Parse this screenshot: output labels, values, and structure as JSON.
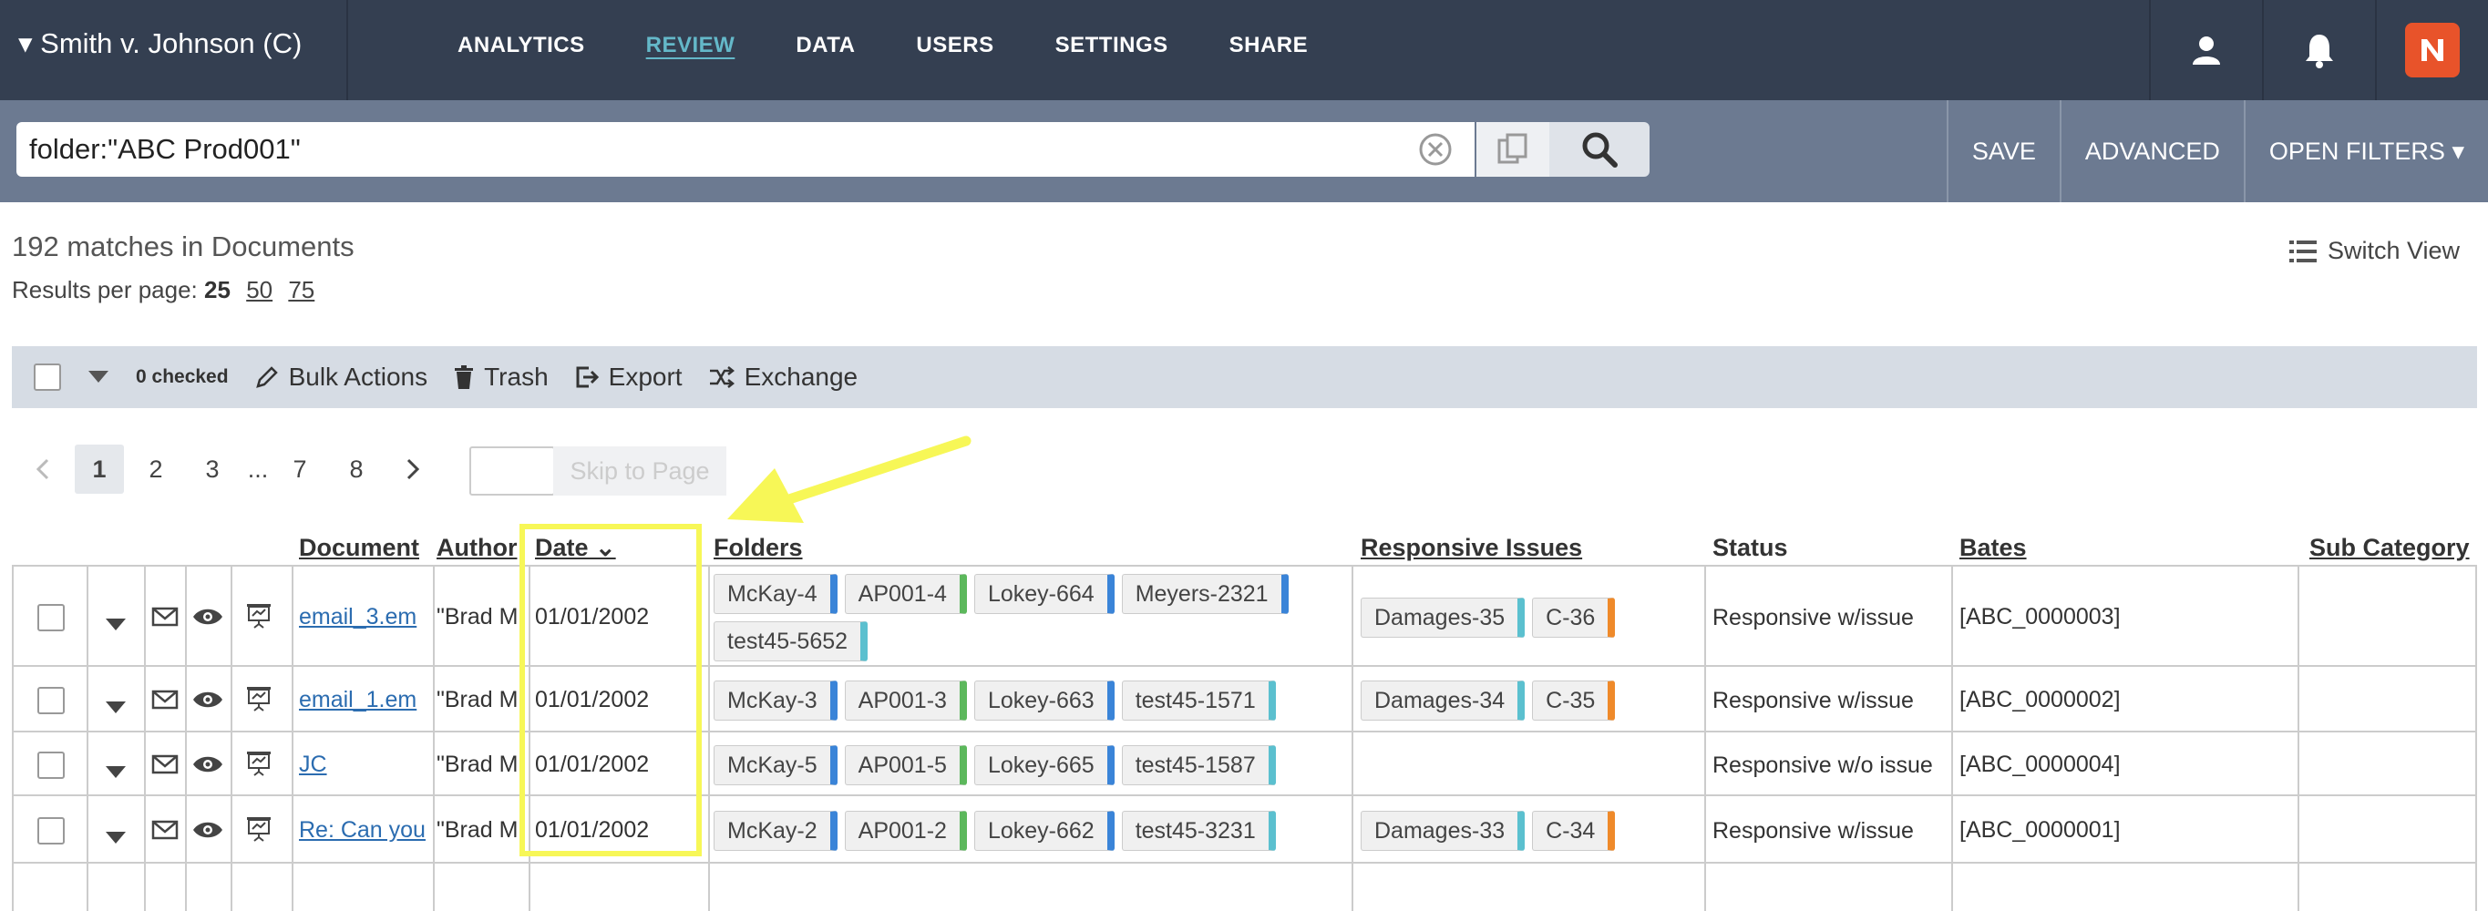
{
  "header": {
    "case_title": "▾ Smith v. Johnson (C)",
    "nav": [
      "ANALYTICS",
      "REVIEW",
      "DATA",
      "USERS",
      "SETTINGS",
      "SHARE"
    ],
    "active_nav": "REVIEW",
    "icons": [
      "user-icon",
      "bell-icon",
      "app-logo-icon"
    ]
  },
  "search": {
    "query": "folder:\"ABC Prod001\"",
    "save_label": "SAVE",
    "advanced_label": "ADVANCED",
    "open_filters_label": "OPEN FILTERS ▾"
  },
  "results": {
    "matches_text": "192 matches in Documents",
    "per_page_label": "Results per page:",
    "per_page_options": [
      "25",
      "50",
      "75"
    ],
    "per_page_selected": "25",
    "switch_view_label": "Switch View"
  },
  "bulkbar": {
    "checked_label": "0 checked",
    "actions": [
      "Bulk Actions",
      "Trash",
      "Export",
      "Exchange"
    ]
  },
  "pagination": {
    "pages": [
      "1",
      "2",
      "3",
      "...",
      "7",
      "8"
    ],
    "current": "1",
    "skip_label": "Skip to Page"
  },
  "table": {
    "columns": [
      "Document",
      "Author",
      "Date ⌄",
      "Folders",
      "Responsive Issues",
      "Status",
      "Bates",
      "Sub Category"
    ],
    "rows": [
      {
        "document": "email_3.em",
        "author": "\"Brad M",
        "date": "01/01/2002",
        "folders": [
          [
            "McKay-4",
            "blue"
          ],
          [
            "AP001-4",
            "green"
          ],
          [
            "Lokey-664",
            "blue"
          ],
          [
            "Meyers-2321",
            "blue"
          ],
          [
            "test45-5652",
            "teal"
          ]
        ],
        "issues": [
          [
            "Damages-35",
            "teal"
          ],
          [
            "C-36",
            "orange"
          ]
        ],
        "status": "Responsive w/issue",
        "bates": "[ABC_0000003]"
      },
      {
        "document": "email_1.em",
        "author": "\"Brad M",
        "date": "01/01/2002",
        "folders": [
          [
            "McKay-3",
            "blue"
          ],
          [
            "AP001-3",
            "green"
          ],
          [
            "Lokey-663",
            "blue"
          ],
          [
            "test45-1571",
            "teal"
          ]
        ],
        "issues": [
          [
            "Damages-34",
            "teal"
          ],
          [
            "C-35",
            "orange"
          ]
        ],
        "status": "Responsive w/issue",
        "bates": "[ABC_0000002]"
      },
      {
        "document": "JC",
        "author": "\"Brad M",
        "date": "01/01/2002",
        "folders": [
          [
            "McKay-5",
            "blue"
          ],
          [
            "AP001-5",
            "green"
          ],
          [
            "Lokey-665",
            "blue"
          ],
          [
            "test45-1587",
            "teal"
          ]
        ],
        "issues": [],
        "status": "Responsive w/o issue",
        "bates": "[ABC_0000004]"
      },
      {
        "document": "Re: Can you",
        "author": "\"Brad M",
        "date": "01/01/2002",
        "folders": [
          [
            "McKay-2",
            "blue"
          ],
          [
            "AP001-2",
            "green"
          ],
          [
            "Lokey-662",
            "blue"
          ],
          [
            "test45-3231",
            "teal"
          ]
        ],
        "issues": [
          [
            "Damages-33",
            "teal"
          ],
          [
            "C-34",
            "orange"
          ]
        ],
        "status": "Responsive w/issue",
        "bates": "[ABC_0000001]"
      }
    ]
  },
  "colors": {
    "topbar": "#343f51",
    "searchbar": "#6c7a91",
    "accent": "#64b8c9",
    "highlight": "#f7f757"
  }
}
